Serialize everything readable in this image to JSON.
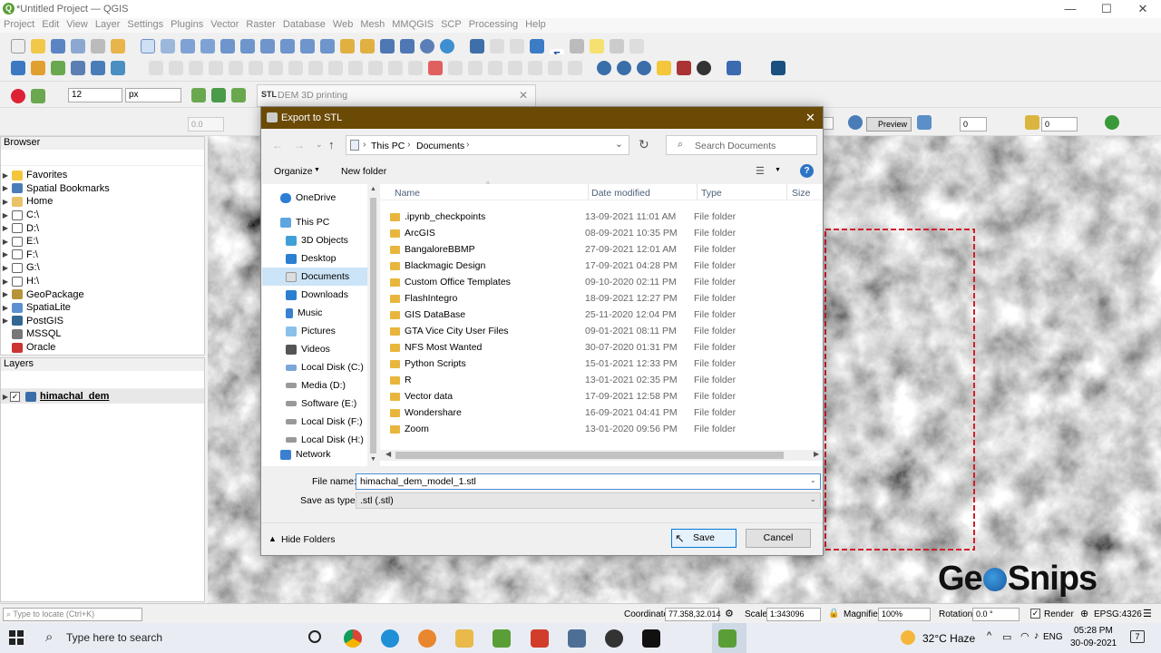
{
  "window": {
    "title": "*Untitled Project — QGIS",
    "min": "—",
    "max": "☐",
    "close": "✕"
  },
  "menu": [
    "Project",
    "Edit",
    "View",
    "Layer",
    "Settings",
    "Plugins",
    "Vector",
    "Raster",
    "Database",
    "Web",
    "Mesh",
    "MMQGIS",
    "SCP",
    "Processing",
    "Help"
  ],
  "digitize": {
    "size_value": "12",
    "unit": "px"
  },
  "render_bar": {
    "zero1": "0.0",
    "preview": "Preview",
    "v1": "0",
    "v2": "0"
  },
  "browser": {
    "title": "Browser",
    "items": [
      "Favorites",
      "Spatial Bookmarks",
      "Home",
      "C:\\",
      "D:\\",
      "E:\\",
      "F:\\",
      "G:\\",
      "H:\\",
      "GeoPackage",
      "SpatiaLite",
      "PostGIS",
      "MSSQL",
      "Oracle"
    ]
  },
  "layers": {
    "title": "Layers",
    "items": [
      "himachal_dem"
    ]
  },
  "stl_dialog": {
    "title": "DEM 3D printing"
  },
  "dialog": {
    "title": "Export to STL",
    "breadcrumb": [
      "This PC",
      "Documents"
    ],
    "search_placeholder": "Search Documents",
    "organize": "Organize",
    "new_folder": "New folder",
    "nav": [
      "OneDrive",
      "This PC",
      "3D Objects",
      "Desktop",
      "Documents",
      "Downloads",
      "Music",
      "Pictures",
      "Videos",
      "Local Disk (C:)",
      "Media (D:)",
      "Software (E:)",
      "Local Disk (F:)",
      "Local Disk (H:)",
      "Network"
    ],
    "columns": {
      "name": "Name",
      "date": "Date modified",
      "type": "Type",
      "size": "Size"
    },
    "files": [
      {
        "name": ".ipynb_checkpoints",
        "date": "13-09-2021 11:01 AM",
        "type": "File folder"
      },
      {
        "name": "ArcGIS",
        "date": "08-09-2021 10:35 PM",
        "type": "File folder"
      },
      {
        "name": "BangaloreBBMP",
        "date": "27-09-2021 12:01 AM",
        "type": "File folder"
      },
      {
        "name": "Blackmagic Design",
        "date": "17-09-2021 04:28 PM",
        "type": "File folder"
      },
      {
        "name": "Custom Office Templates",
        "date": "09-10-2020 02:11 PM",
        "type": "File folder"
      },
      {
        "name": "FlashIntegro",
        "date": "18-09-2021 12:27 PM",
        "type": "File folder"
      },
      {
        "name": "GIS DataBase",
        "date": "25-11-2020 12:04 PM",
        "type": "File folder"
      },
      {
        "name": "GTA Vice City User Files",
        "date": "09-01-2021 08:11 PM",
        "type": "File folder"
      },
      {
        "name": "NFS Most Wanted",
        "date": "30-07-2020 01:31 PM",
        "type": "File folder"
      },
      {
        "name": "Python Scripts",
        "date": "15-01-2021 12:33 PM",
        "type": "File folder"
      },
      {
        "name": "R",
        "date": "13-01-2021 02:35 PM",
        "type": "File folder"
      },
      {
        "name": "Vector data",
        "date": "17-09-2021 12:58 PM",
        "type": "File folder"
      },
      {
        "name": "Wondershare",
        "date": "16-09-2021 04:41 PM",
        "type": "File folder"
      },
      {
        "name": "Zoom",
        "date": "13-01-2020 09:56 PM",
        "type": "File folder"
      }
    ],
    "file_name_label": "File name:",
    "file_name_value": "himachal_dem_model_1.stl",
    "save_type_label": "Save as type:",
    "save_type_value": ".stl (.stl)",
    "hide_folders": "Hide Folders",
    "save": "Save",
    "cancel": "Cancel"
  },
  "status": {
    "locate_placeholder": "Type to locate (Ctrl+K)",
    "coordinate_label": "Coordinate",
    "coordinate_value": "77.358,32.014",
    "scale_label": "Scale",
    "scale_value": "1:343096",
    "magnifier_label": "Magnifier",
    "magnifier_value": "100%",
    "rotation_label": "Rotation",
    "rotation_value": "0.0 °",
    "render_label": "Render",
    "crs": "EPSG:4326"
  },
  "watermark": {
    "part1": "Ge",
    "part2": "Snips"
  },
  "taskbar": {
    "search_placeholder": "Type here to search",
    "weather": "32°C  Haze",
    "lang": "ENG",
    "time": "05:28 PM",
    "date": "30-09-2021",
    "notif": "7"
  },
  "colors": {
    "dialog_title_bg": "#6b4a06",
    "accent": "#0078d7",
    "extent_box": "#d0202a"
  }
}
